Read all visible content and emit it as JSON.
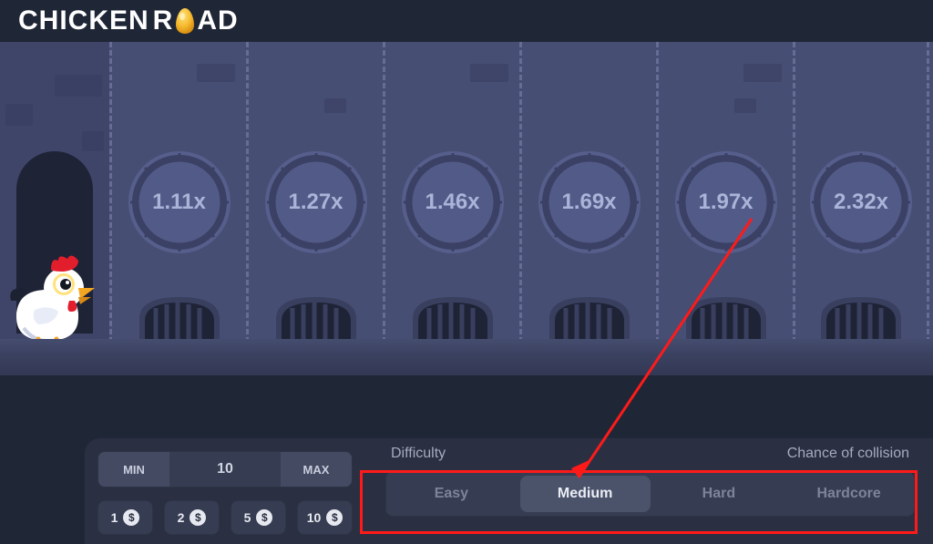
{
  "header": {
    "title_left": "CHICKEN",
    "title_right": "ROAD",
    "o_replacement_icon": "egg-icon"
  },
  "stage": {
    "manholes": [
      {
        "multiplier": "1.11x"
      },
      {
        "multiplier": "1.27x"
      },
      {
        "multiplier": "1.46x"
      },
      {
        "multiplier": "1.69x"
      },
      {
        "multiplier": "1.97x"
      },
      {
        "multiplier": "2.32x"
      }
    ]
  },
  "controls": {
    "bet_min_label": "MIN",
    "bet_max_label": "MAX",
    "bet_value": "10",
    "quick_chips": [
      {
        "amount": "1",
        "symbol": "$"
      },
      {
        "amount": "2",
        "symbol": "$"
      },
      {
        "amount": "5",
        "symbol": "$"
      },
      {
        "amount": "10",
        "symbol": "$"
      }
    ],
    "difficulty_label": "Difficulty",
    "collision_label": "Chance of collision",
    "difficulties": [
      {
        "label": "Easy",
        "active": false
      },
      {
        "label": "Medium",
        "active": true
      },
      {
        "label": "Hard",
        "active": false
      },
      {
        "label": "Hardcore",
        "active": false
      }
    ]
  },
  "annotation": {
    "type": "highlight-arrow",
    "target": "difficulty-selector",
    "color": "#ff1a1a"
  }
}
